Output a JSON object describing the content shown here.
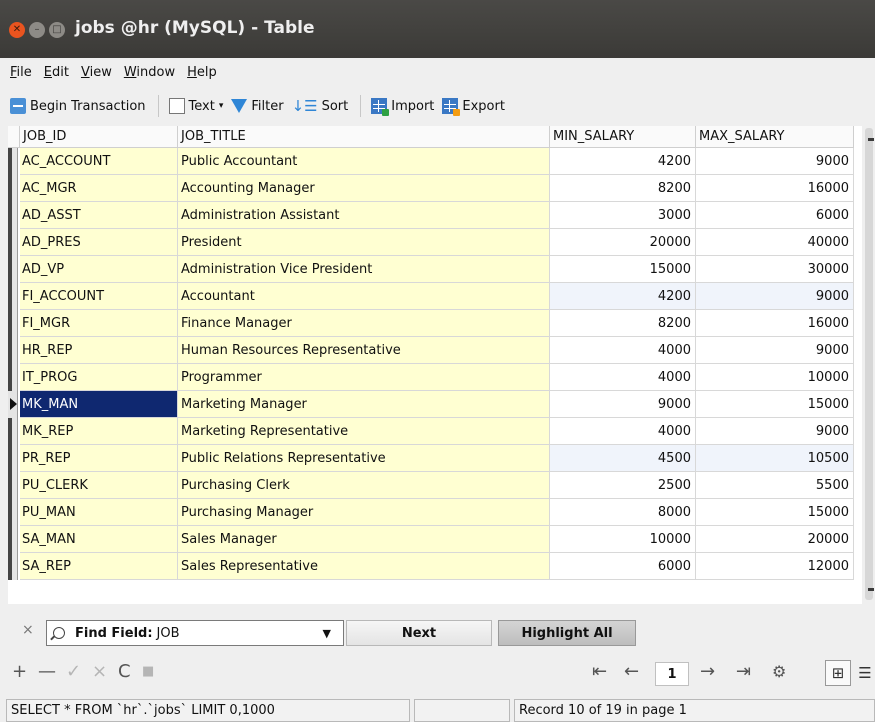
{
  "window": {
    "title": "jobs @hr (MySQL) - Table",
    "close_glyph": "✕",
    "min_glyph": "–",
    "max_glyph": "□"
  },
  "menu": [
    {
      "label": "File",
      "mnemonic": "F",
      "rest": "ile"
    },
    {
      "label": "Edit",
      "mnemonic": "E",
      "rest": "dit"
    },
    {
      "label": "View",
      "mnemonic": "V",
      "rest": "iew"
    },
    {
      "label": "Window",
      "mnemonic": "W",
      "rest": "indow"
    },
    {
      "label": "Help",
      "mnemonic": "H",
      "rest": "elp"
    }
  ],
  "toolbar": {
    "begin_transaction": "Begin Transaction",
    "text": "Text",
    "text_caret": "▾",
    "filter": "Filter",
    "sort_glyph": "↓☰",
    "sort": "Sort",
    "import": "Import",
    "export": "Export"
  },
  "table": {
    "columns": [
      "JOB_ID",
      "JOB_TITLE",
      "MIN_SALARY",
      "MAX_SALARY"
    ],
    "selected_row": 9,
    "rows": [
      [
        "AC_ACCOUNT",
        "Public Accountant",
        "4200",
        "9000"
      ],
      [
        "AC_MGR",
        "Accounting Manager",
        "8200",
        "16000"
      ],
      [
        "AD_ASST",
        "Administration Assistant",
        "3000",
        "6000"
      ],
      [
        "AD_PRES",
        "President",
        "20000",
        "40000"
      ],
      [
        "AD_VP",
        "Administration Vice President",
        "15000",
        "30000"
      ],
      [
        "FI_ACCOUNT",
        "Accountant",
        "4200",
        "9000"
      ],
      [
        "FI_MGR",
        "Finance Manager",
        "8200",
        "16000"
      ],
      [
        "HR_REP",
        "Human Resources Representative",
        "4000",
        "9000"
      ],
      [
        "IT_PROG",
        "Programmer",
        "4000",
        "10000"
      ],
      [
        "MK_MAN",
        "Marketing Manager",
        "9000",
        "15000"
      ],
      [
        "MK_REP",
        "Marketing Representative",
        "4000",
        "9000"
      ],
      [
        "PR_REP",
        "Public Relations Representative",
        "4500",
        "10500"
      ],
      [
        "PU_CLERK",
        "Purchasing Clerk",
        "2500",
        "5500"
      ],
      [
        "PU_MAN",
        "Purchasing Manager",
        "8000",
        "15000"
      ],
      [
        "SA_MAN",
        "Sales Manager",
        "10000",
        "20000"
      ],
      [
        "SA_REP",
        "Sales Representative",
        "6000",
        "12000"
      ]
    ]
  },
  "find": {
    "close_glyph": "×",
    "label": "Find Field:",
    "value": "JOB",
    "dropdown_glyph": "▼",
    "next": "Next",
    "highlight_all": "Highlight All"
  },
  "bottom_toolbar": {
    "add": "+",
    "remove": "—",
    "apply": "✓",
    "discard": "×",
    "refresh": "C",
    "stop": "■",
    "first": "⇤",
    "prev": "←",
    "page": "1",
    "next": "→",
    "last": "⇥",
    "settings": "⚙",
    "grid_view": "⊞",
    "form_view": "☰"
  },
  "status": {
    "query": "SELECT * FROM `hr`.`jobs` LIMIT 0,1000",
    "middle": "",
    "record": "Record 10 of 19 in page 1"
  }
}
